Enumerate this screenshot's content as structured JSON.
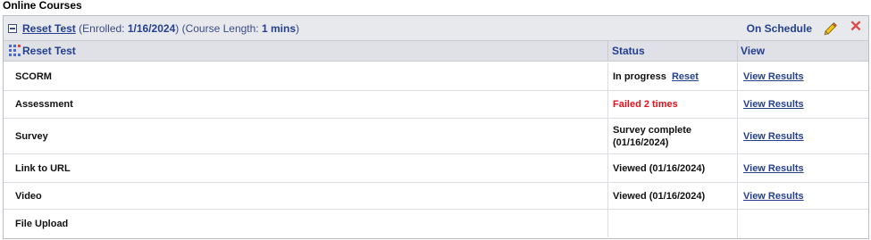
{
  "section_title": "Online Courses",
  "course": {
    "name": "Reset Test",
    "enrolled_label": "(Enrolled:",
    "enrolled_date": "1/16/2024",
    "close_paren": ")",
    "length_label": "(Course Length:",
    "length_value": "1 mins",
    "length_close": ")",
    "schedule_status": "On Schedule",
    "edit_icon": "pencil-icon",
    "delete_icon": "delete-x-icon",
    "delete_glyph": "✕",
    "accent_color": "#24408e",
    "failed_color": "#e3101b"
  },
  "table": {
    "columns": [
      "Reset Test",
      "Status",
      "View"
    ],
    "rows": [
      {
        "name": "SCORM",
        "status": "In progress",
        "status_link": "Reset",
        "view": "View Results"
      },
      {
        "name": "Assessment",
        "status": "Failed 2 times",
        "view": "View Results"
      },
      {
        "name": "Survey",
        "status": "Survey complete",
        "status_line2": "(01/16/2024)",
        "view": "View Results"
      },
      {
        "name": "Link to URL",
        "status": "Viewed (01/16/2024)",
        "view": "View Results"
      },
      {
        "name": "Video",
        "status": "Viewed (01/16/2024)",
        "view": "View Results"
      },
      {
        "name": "File Upload",
        "status": "",
        "view": ""
      }
    ]
  }
}
